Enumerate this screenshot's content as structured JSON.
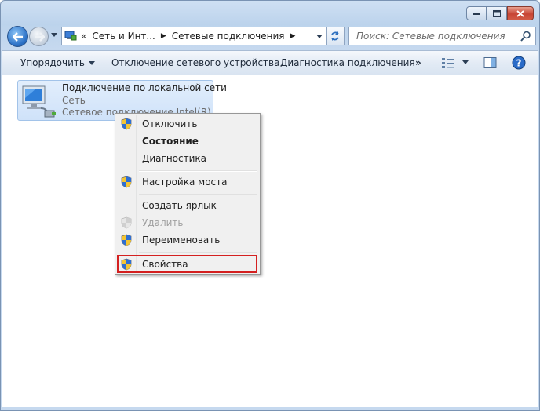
{
  "colors": {
    "window_frame": "#c6d9ef",
    "selection": "#cfe2f9",
    "highlight_border": "#d42020",
    "close_button": "#c74535"
  },
  "window": {
    "buttons": {
      "minimize": "minimize-icon",
      "maximize": "maximize-icon",
      "close": "close-icon"
    }
  },
  "nav": {
    "breadcrumb_prefix": "«",
    "crumbs": [
      "Сеть и Инт...",
      "Сетевые подключения"
    ],
    "search_placeholder": "Поиск: Сетевые подключения"
  },
  "toolbar": {
    "organize": "Упорядочить",
    "disable": "Отключение сетевого устройства",
    "diagnose": "Диагностика подключения",
    "more": "»"
  },
  "connection": {
    "name": "Подключение по локальной сети",
    "network": "Сеть",
    "device": "Сетевое подключение Intel(R) P..."
  },
  "context_menu": {
    "items": [
      {
        "label": "Отключить",
        "shield": true
      },
      {
        "label": "Состояние",
        "bold": true
      },
      {
        "label": "Диагностика"
      },
      {
        "label": "Настройка моста",
        "shield": true
      },
      {
        "label": "Создать ярлык"
      },
      {
        "label": "Удалить",
        "disabled": true,
        "shield": true
      },
      {
        "label": "Переименовать",
        "shield": true
      },
      {
        "label": "Свойства",
        "shield": true,
        "highlighted": true
      }
    ]
  }
}
